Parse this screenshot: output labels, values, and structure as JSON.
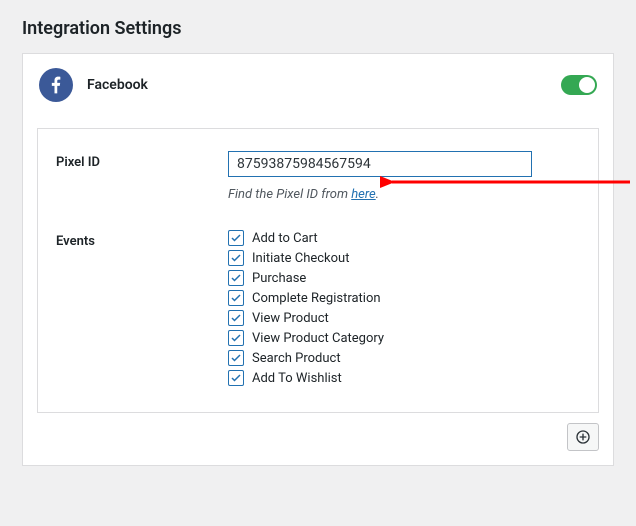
{
  "page_title": "Integration Settings",
  "integration": {
    "name": "Facebook",
    "enabled": true
  },
  "fields": {
    "pixel_id": {
      "label": "Pixel ID",
      "value": "87593875984567594",
      "hint_prefix": "Find the Pixel ID from ",
      "hint_link_text": "here",
      "hint_suffix": "."
    },
    "events": {
      "label": "Events",
      "items": [
        {
          "label": "Add to Cart",
          "checked": true
        },
        {
          "label": "Initiate Checkout",
          "checked": true
        },
        {
          "label": "Purchase",
          "checked": true
        },
        {
          "label": "Complete Registration",
          "checked": true
        },
        {
          "label": "View Product",
          "checked": true
        },
        {
          "label": "View Product Category",
          "checked": true
        },
        {
          "label": "Search Product",
          "checked": true
        },
        {
          "label": "Add To Wishlist",
          "checked": true
        }
      ]
    }
  },
  "colors": {
    "facebook": "#3b5998",
    "toggle_on": "#34a853",
    "accent": "#2271b1",
    "arrow": "#ff0000"
  }
}
